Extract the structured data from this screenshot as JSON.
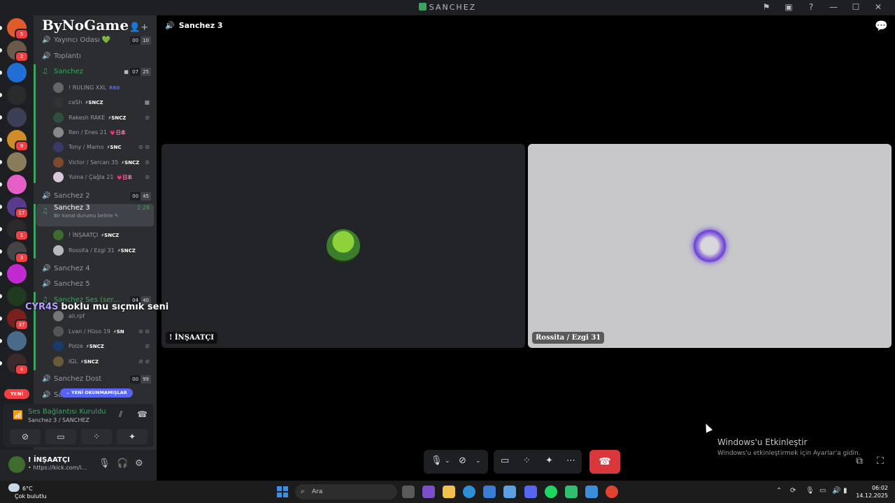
{
  "window": {
    "title": "SANCHEZ",
    "controls": [
      "flag-icon",
      "monitor-icon",
      "help-icon",
      "minimize-icon",
      "maximize-icon",
      "close-icon"
    ]
  },
  "server_rail": {
    "servers": [
      {
        "color": "#e05a2b",
        "badge": "5"
      },
      {
        "color": "#6b5a4a",
        "badge": "2"
      },
      {
        "color": "#1f6fd6",
        "badge": ""
      },
      {
        "color": "#2a2a2a",
        "badge": ""
      },
      {
        "color": "#3a3f55",
        "badge": ""
      },
      {
        "color": "#d08c2a",
        "badge": "9"
      },
      {
        "color": "#8a7b5a",
        "badge": ""
      },
      {
        "color": "#e65fc8",
        "badge": ""
      },
      {
        "color": "#5a3a8a",
        "badge": "17"
      },
      {
        "color": "#2a2a2a",
        "badge": "1"
      },
      {
        "color": "#444444",
        "badge": "3"
      },
      {
        "color": "#c02ad0",
        "badge": ""
      },
      {
        "color": "#1f3a1f",
        "badge": ""
      },
      {
        "color": "#7a1f1f",
        "badge": "37"
      },
      {
        "color": "#4a6a8a",
        "badge": ""
      },
      {
        "color": "#3a2a2a",
        "badge": "4"
      }
    ],
    "new_label": "YENİ"
  },
  "sidebar": {
    "server_logo": "ByNoGame",
    "channels": {
      "yayinci": {
        "name": "Yayıncı Odası 💚",
        "a": "00",
        "b": "10"
      },
      "toplanti": {
        "name": "Toplantı"
      },
      "sanchez": {
        "name": "Sanchez",
        "a": "07",
        "b": "25"
      },
      "sanchez2": {
        "name": "Sanchez 2",
        "a": "00",
        "b": "45"
      },
      "sanchez3": {
        "name": "Sanchez 3",
        "timer": "2:28",
        "status": "Bir kanal durumu belirle ✎"
      },
      "sanchez4": {
        "name": "Sanchez 4"
      },
      "sanchez5": {
        "name": "Sanchez 5"
      },
      "ses": {
        "name": "Sanchez Ses (ser...",
        "a": "04",
        "b": "40"
      },
      "dost": {
        "name": "Sanchez Dost",
        "a": "00",
        "b": "99"
      },
      "next": {
        "name": "Sa..."
      }
    },
    "sanchez_users": [
      {
        "name": "! RULING XXL",
        "tag": "R60",
        "tagClass": "b",
        "icon": ""
      },
      {
        "name": "caSh",
        "tag": "⚡SNCZ",
        "tagClass": "",
        "icon": "■"
      },
      {
        "name": "Rakesh RAKE",
        "tag": "⚡SNCZ",
        "tagClass": "",
        "icon": "⊘"
      },
      {
        "name": "Ren / Enes 21",
        "tag": "💗日本",
        "tagClass": "p",
        "icon": ""
      },
      {
        "name": "Tony / Mamo",
        "tag": "⚡SNC",
        "tagClass": "",
        "icon": "⊘ ⊘"
      },
      {
        "name": "Victor / Sercan 35",
        "tag": "⚡SNCZ",
        "tagClass": "",
        "icon": "⊘"
      },
      {
        "name": "Yuina / Çağla 21",
        "tag": "💗日本",
        "tagClass": "p",
        "icon": "⊘"
      }
    ],
    "sanchez3_users": [
      {
        "name": "! İNŞAATÇI",
        "tag": "⚡SNCZ"
      },
      {
        "name": "Rossita / Ezgi 31",
        "tag": "⚡SNCZ"
      }
    ],
    "ses_users": [
      {
        "name": "ali.rpf",
        "tag": "",
        "icon": ""
      },
      {
        "name": "Lvan / Hüso 19",
        "tag": "⚡SN",
        "icon": "⊘ ⊘"
      },
      {
        "name": "Polze",
        "tag": "⚡SNCZ",
        "icon": "⊘"
      },
      {
        "name": "IGL",
        "tag": "⚡SNCZ",
        "icon": "⊘ ⊘"
      }
    ],
    "overlay": {
      "who": "CYR4S",
      "msg": "boklu mu sıçmık seni"
    },
    "unread_label": "⌄ YENİ OKUNMAMIŞLAR"
  },
  "voice_panel": {
    "title": "Ses Bağlantısı Kuruldu",
    "subtitle": "Sanchez 3 / SANCHEZ"
  },
  "user_panel": {
    "name": "! İNŞAATÇI",
    "subtitle": "• https://kick.com/i..."
  },
  "main": {
    "channel_title": "Sanchez 3",
    "tiles": [
      {
        "name": "! İNŞAATÇI"
      },
      {
        "name": "Rossita / Ezgi 31"
      }
    ],
    "activation": {
      "line1": "Windows'u Etkinleştir",
      "line2": "Windows'u etkinleştirmek için Ayarlar'a gidin."
    }
  },
  "taskbar": {
    "weather_temp": "6°C",
    "weather_desc": "Çok bulutlu",
    "weather_badge": "5",
    "search_placeholder": "Ara",
    "time": "06:02",
    "date": "14.12.2025"
  }
}
